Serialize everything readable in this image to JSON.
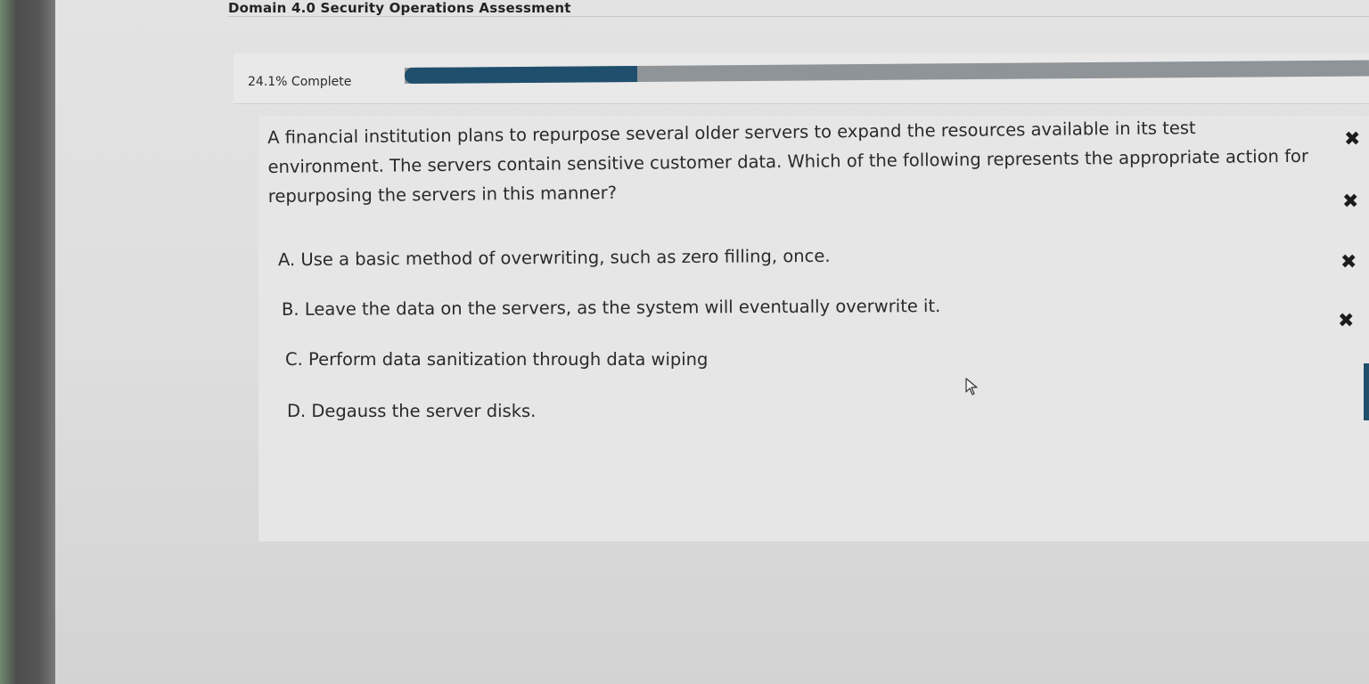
{
  "header": {
    "title": "Domain 4.0 Security Operations Assessment"
  },
  "progress": {
    "label": "24.1% Complete",
    "percent": 24.1
  },
  "question": {
    "text": "A financial institution plans to repurpose several older servers to expand the resources available in its test environment. The servers contain sensitive customer data. Which of the following represents the appropriate action for repurposing the servers in this manner?",
    "options": [
      {
        "label": "A. Use a basic method of overwriting, such as zero filling, once."
      },
      {
        "label": "B. Leave the data on the servers, as the system will eventually overwrite it."
      },
      {
        "label": "C. Perform data sanitization through data wiping"
      },
      {
        "label": "D. Degauss the server disks."
      }
    ]
  },
  "marks": {
    "symbol": "✖"
  },
  "colors": {
    "progress_fill": "#1f4f6c",
    "progress_track": "#8f9499"
  },
  "icons": {
    "cursor": "mouse-pointer-icon",
    "mark": "x-mark-icon"
  }
}
